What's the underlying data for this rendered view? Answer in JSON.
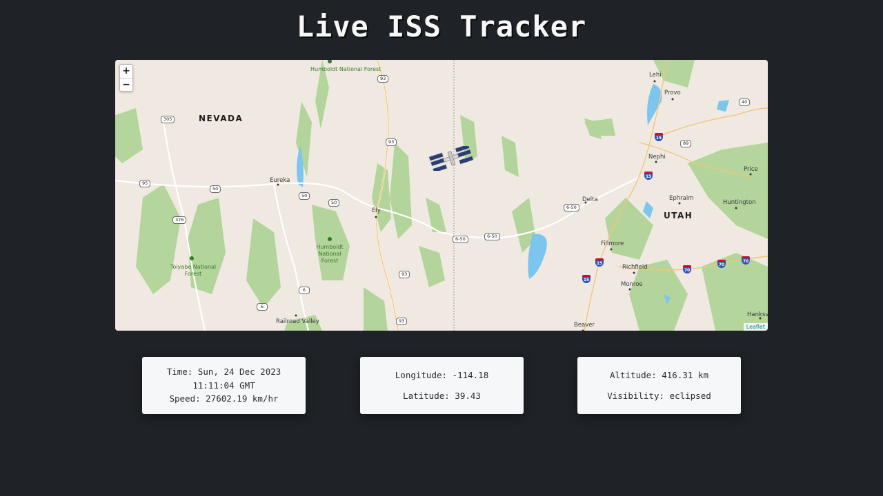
{
  "page": {
    "title": "Live ISS Tracker"
  },
  "map": {
    "zoom_in": "+",
    "zoom_out": "−",
    "attribution": "Leaflet",
    "states": [
      "NEVADA",
      "UTAH"
    ],
    "cities": {
      "eureka": "Eureka",
      "ely": "Ely",
      "railroad_valley": "Railroad Valley",
      "lehi": "Lehi",
      "provo": "Provo",
      "nephi": "Nephi",
      "price": "Price",
      "delta": "Delta",
      "ephraim": "Ephraim",
      "huntington": "Huntington",
      "fillmore": "Fillmore",
      "richfield": "Richfield",
      "monroe": "Monroe",
      "beaver": "Beaver",
      "hanksville": "Hanksvil"
    },
    "forests": {
      "humboldt_north": "Humboldt National Forest",
      "humboldt_south": "Humboldt National Forest",
      "toiyabe": "Toiyabe National Forest"
    },
    "routes": {
      "us93_a": "93",
      "us93_b": "93",
      "us93_c": "93",
      "us93_d": "93",
      "us305": "305",
      "us50_a": "50",
      "us50_b": "50",
      "us50_c": "50",
      "us95": "95",
      "us376": "376",
      "us6_a": "6",
      "us6_b": "6",
      "us6_50_a": "6-50",
      "us6_50_b": "6-50",
      "us6_50_c": "6-50",
      "us89": "89",
      "us40": "40",
      "i15_a": "15",
      "i15_b": "15",
      "i15_c": "15",
      "i15_d": "15",
      "i70_a": "70",
      "i70_b": "70",
      "i70_c": "70"
    },
    "iss_marker_icon": "satellite-icon"
  },
  "info": {
    "time_line1": "Time: Sun, 24 Dec 2023",
    "time_line2": "11:11:04 GMT",
    "speed": "Speed: 27602.19 km/hr",
    "longitude": "Longitude: -114.18",
    "latitude": "Latitude: 39.43",
    "altitude": "Altitude: 416.31 km",
    "visibility": "Visibility: eclipsed"
  },
  "colors": {
    "background": "#1f2227",
    "card": "#f6f7f9",
    "water": "#7cc6ee",
    "forest": "#a9d18e"
  }
}
